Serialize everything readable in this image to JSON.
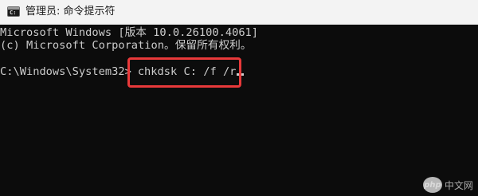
{
  "window": {
    "title": "管理员: 命令提示符",
    "icon": "cmd-console-icon"
  },
  "console": {
    "lines": [
      "Microsoft Windows [版本 10.0.26100.4061]",
      "(c) Microsoft Corporation。保留所有权利。",
      "",
      "C:\\Windows\\System32>"
    ],
    "command": "chkdsk C: /f /r",
    "text_color": "#cccccc",
    "background": "#0c0c0c"
  },
  "highlight": {
    "color": "#e8393a"
  },
  "watermark": {
    "logo_text": "php",
    "text": "中文网"
  }
}
